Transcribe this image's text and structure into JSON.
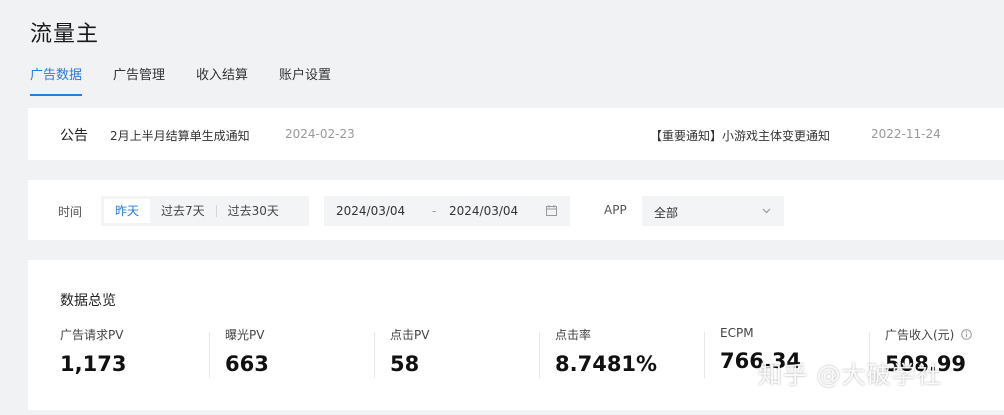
{
  "app": {
    "title": "流量主"
  },
  "tabs": [
    {
      "label": "广告数据",
      "active": true
    },
    {
      "label": "广告管理"
    },
    {
      "label": "收入结算"
    },
    {
      "label": "账户设置"
    }
  ],
  "notice": {
    "label": "公告",
    "items": [
      {
        "text": "2月上半月结算单生成通知",
        "date": "2024-02-23"
      },
      {
        "text": "【重要通知】小游戏主体变更通知",
        "date": "2022-11-24"
      }
    ]
  },
  "filter": {
    "time_label": "时间",
    "time_options": [
      "昨天",
      "过去7天",
      "过去30天"
    ],
    "selected_time": "昨天",
    "date_start": "2024/03/04",
    "date_sep": "-",
    "date_end": "2024/03/04",
    "app_label": "APP",
    "app_value": "全部"
  },
  "overview": {
    "title": "数据总览",
    "stats": [
      {
        "label": "广告请求PV",
        "value": "1,173"
      },
      {
        "label": "曝光PV",
        "value": "663"
      },
      {
        "label": "点击PV",
        "value": "58"
      },
      {
        "label": "点击率",
        "value": "8.7481%"
      },
      {
        "label": "ECPM",
        "value": "766.34"
      },
      {
        "label": "广告收入(元)",
        "value": "508.99"
      }
    ]
  },
  "watermark": "知乎 @大破学社",
  "colors": {
    "accent": "#2b7bd8",
    "background": "#f1f2f4",
    "card": "#ffffff"
  }
}
